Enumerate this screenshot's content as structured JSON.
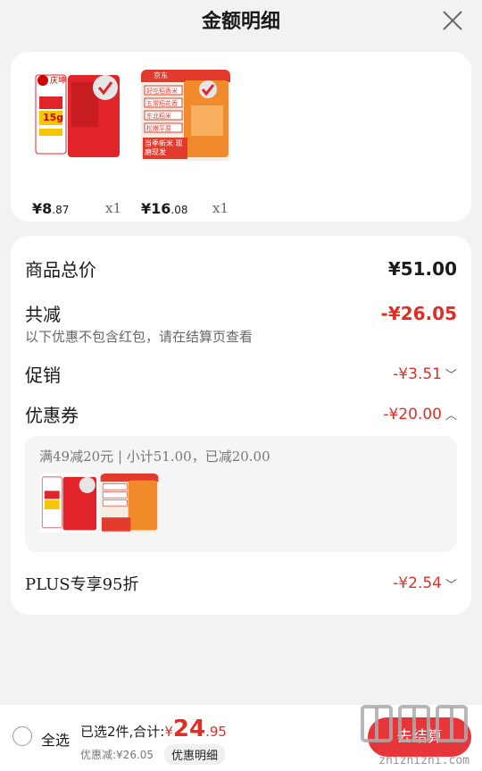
{
  "header": {
    "title": "金额明细"
  },
  "products": [
    {
      "brand": "庆坤",
      "badge": "15g",
      "price_int": "¥8",
      "price_dec": ".87",
      "qty": "x1"
    },
    {
      "brand": "京东",
      "tags": [
        "好吃稻香米",
        "五常稻花香",
        "东北稻米",
        "松嫩平原"
      ],
      "banner": "当季新米 现磨现发",
      "price_int": "¥16",
      "price_dec": ".08",
      "qty": "x1"
    }
  ],
  "detail": {
    "total_label": "商品总价",
    "total_value": "¥51.00",
    "reduce_label": "共减",
    "reduce_value": "-¥26.05",
    "reduce_note": "以下优惠不包含红包，请在结算页查看",
    "promo_label": "促销",
    "promo_value": "-¥3.51",
    "coupon_label": "优惠券",
    "coupon_value": "-¥20.00",
    "coupon_text": "满49减20元 | 小计51.00，已减20.00",
    "plus_label": "PLUS专享95折",
    "plus_value": "-¥2.54"
  },
  "bottom": {
    "select_all": "全选",
    "summary_prefix": "已选2件,合计:",
    "total_symbol": "¥",
    "total_int": "24",
    "total_dec": ".95",
    "saved": "优惠减:¥26.05",
    "detail_button": "优惠明细",
    "checkout": "去结算"
  },
  "watermark": {
    "text": "zhizhizhi.com",
    "logo": "值值值"
  },
  "colors": {
    "accent": "#e02e24",
    "checkout": "#e8353a"
  }
}
